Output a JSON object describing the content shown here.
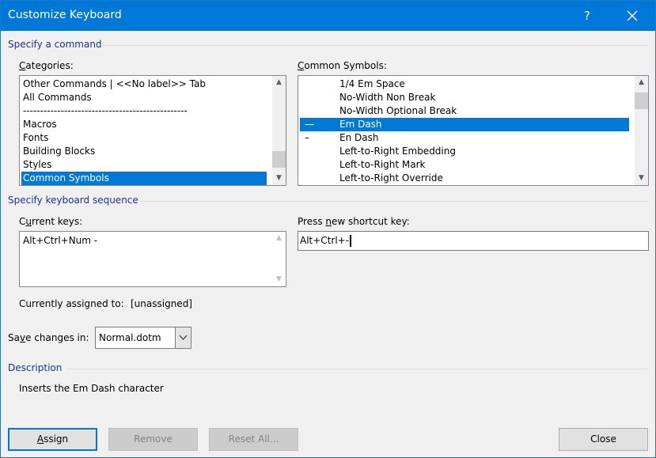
{
  "window": {
    "title": "Customize Keyboard",
    "help_glyph": "?",
    "close_glyph": "✕"
  },
  "specify_command": {
    "group_label": "Specify a command",
    "categories": {
      "label_prefix": "",
      "label_accel": "C",
      "label_rest": "ategories:",
      "items": [
        "Other Commands | <<No label>> Tab",
        "All Commands",
        "------------------------------------------------",
        "Macros",
        "Fonts",
        "Building Blocks",
        "Styles",
        "Common Symbols"
      ],
      "selected": "Common Symbols"
    },
    "symbols": {
      "label_prefix": "",
      "label_accel": "C",
      "label_rest": "ommon Symbols:",
      "items": [
        {
          "glyph": "",
          "name": "1/4 Em Space"
        },
        {
          "glyph": "",
          "name": "No-Width Non Break"
        },
        {
          "glyph": "",
          "name": "No-Width Optional Break"
        },
        {
          "glyph": "—",
          "name": "Em Dash"
        },
        {
          "glyph": "–",
          "name": "En Dash"
        },
        {
          "glyph": "",
          "name": "Left-to-Right Embedding"
        },
        {
          "glyph": "",
          "name": "Left-to-Right Mark"
        },
        {
          "glyph": "",
          "name": "Left-to-Right Override"
        }
      ],
      "selected": "Em Dash"
    }
  },
  "keyboard_sequence": {
    "group_label": "Specify keyboard sequence",
    "current_keys": {
      "label_prefix": "C",
      "label_accel": "u",
      "label_rest": "rrent keys:",
      "items": [
        "Alt+Ctrl+Num -"
      ]
    },
    "new_shortcut": {
      "label_prefix": "Press ",
      "label_accel": "n",
      "label_rest": "ew shortcut key:",
      "value": "Alt+Ctrl+-"
    },
    "assigned": {
      "label": "Currently assigned to:",
      "value": "[unassigned]"
    }
  },
  "save_changes": {
    "label_prefix": "Sa",
    "label_accel": "v",
    "label_rest": "e changes in:",
    "value": "Normal.dotm"
  },
  "description": {
    "group_label": "Description",
    "text": "Inserts the Em Dash character"
  },
  "buttons": {
    "assign": {
      "accel": "A",
      "rest": "ssign"
    },
    "remove": "Remove",
    "reset_all": "Reset All...",
    "close": "Close"
  }
}
